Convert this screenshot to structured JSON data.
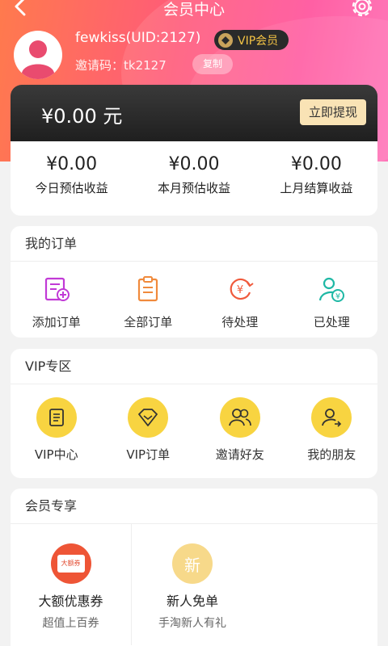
{
  "header": {
    "title": "会员中心",
    "username": "fewkiss(UID:2127)",
    "vip_badge": "VIP会员",
    "invite_code": "邀请码：tk2127",
    "copy_label": "复制"
  },
  "balance": {
    "amount": "¥0.00 元",
    "withdraw_label": "立即提现"
  },
  "earnings": [
    {
      "value": "¥0.00",
      "label": "今日预估收益"
    },
    {
      "value": "¥0.00",
      "label": "本月预估收益"
    },
    {
      "value": "¥0.00",
      "label": "上月结算收益"
    }
  ],
  "orders": {
    "title": "我的订单",
    "items": [
      {
        "label": "添加订单",
        "icon": "add-order-icon"
      },
      {
        "label": "全部订单",
        "icon": "clipboard-icon"
      },
      {
        "label": "待处理",
        "icon": "pending-yuan-icon"
      },
      {
        "label": "已处理",
        "icon": "processed-user-icon"
      }
    ]
  },
  "vip_zone": {
    "title": "VIP专区",
    "items": [
      {
        "label": "VIP中心",
        "icon": "document-icon"
      },
      {
        "label": "VIP订单",
        "icon": "diamond-icon"
      },
      {
        "label": "邀请好友",
        "icon": "users-icon"
      },
      {
        "label": "我的朋友",
        "icon": "friend-icon"
      }
    ]
  },
  "perks": {
    "title": "会员专享",
    "items": [
      {
        "title": "大额优惠券",
        "subtitle": "超值上百券",
        "icon_text": "大额券"
      },
      {
        "title": "新人免单",
        "subtitle": "手淘新人有礼",
        "icon_text": "新"
      }
    ]
  },
  "colors": {
    "header_start": "#ff7a4d",
    "header_end": "#ff4f9a",
    "vip_yellow": "#f8d441",
    "withdraw_bg": "#f9e3b5"
  }
}
